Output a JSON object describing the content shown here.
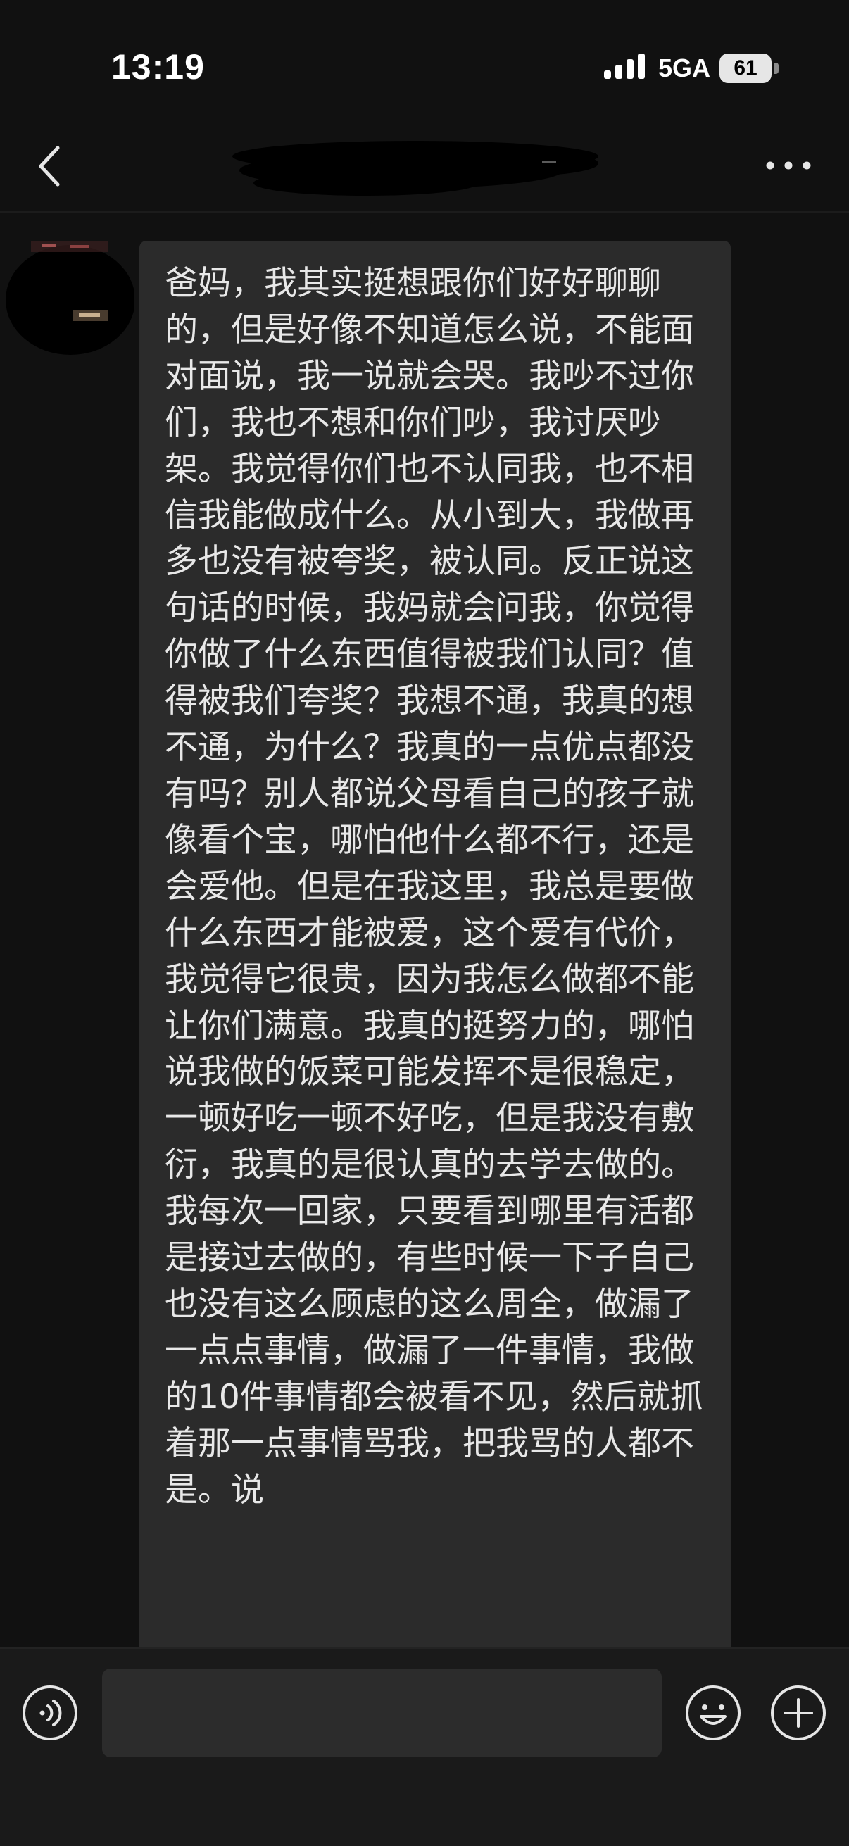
{
  "status_bar": {
    "time": "13:19",
    "network": "5GA",
    "battery": "61"
  },
  "nav": {
    "back_icon": "chevron-left-icon",
    "more_icon": "more-dots-icon"
  },
  "messages": [
    {
      "sender": "contact",
      "text": "爸妈，我其实挺想跟你们好好聊聊的，但是好像不知道怎么说，不能面对面说，我一说就会哭。我吵不过你们，我也不想和你们吵，我讨厌吵架。我觉得你们也不认同我，也不相信我能做成什么。从小到大，我做再多也没有被夸奖，被认同。反正说这句话的时候，我妈就会问我，你觉得你做了什么东西值得被我们认同？值得被我们夸奖？我想不通，我真的想不通，为什么？我真的一点优点都没有吗？别人都说父母看自己的孩子就像看个宝，哪怕他什么都不行，还是会爱他。但是在我这里，我总是要做什么东西才能被爱，这个爱有代价，我觉得它很贵，因为我怎么做都不能让你们满意。我真的挺努力的，哪怕说我做的饭菜可能发挥不是很稳定，一顿好吃一顿不好吃，但是我没有敷衍，我真的是很认真的去学去做的。我每次一回家，只要看到哪里有活都是接过去做的，有些时候一下子自己也没有这么顾虑的这么周全，做漏了一点点事情，做漏了一件事情，我做的10件事情都会被看不见，然后就抓着那一点事情骂我，把我骂的人都不是。说"
    }
  ],
  "input_bar": {
    "voice_icon": "voice-input-icon",
    "input_value": "",
    "emoji_icon": "emoji-icon",
    "plus_icon": "plus-icon"
  },
  "colors": {
    "background": "#111111",
    "bubble": "#2b2b2b",
    "input_bar": "#1a1a1a",
    "text": "#e8e8e8"
  }
}
